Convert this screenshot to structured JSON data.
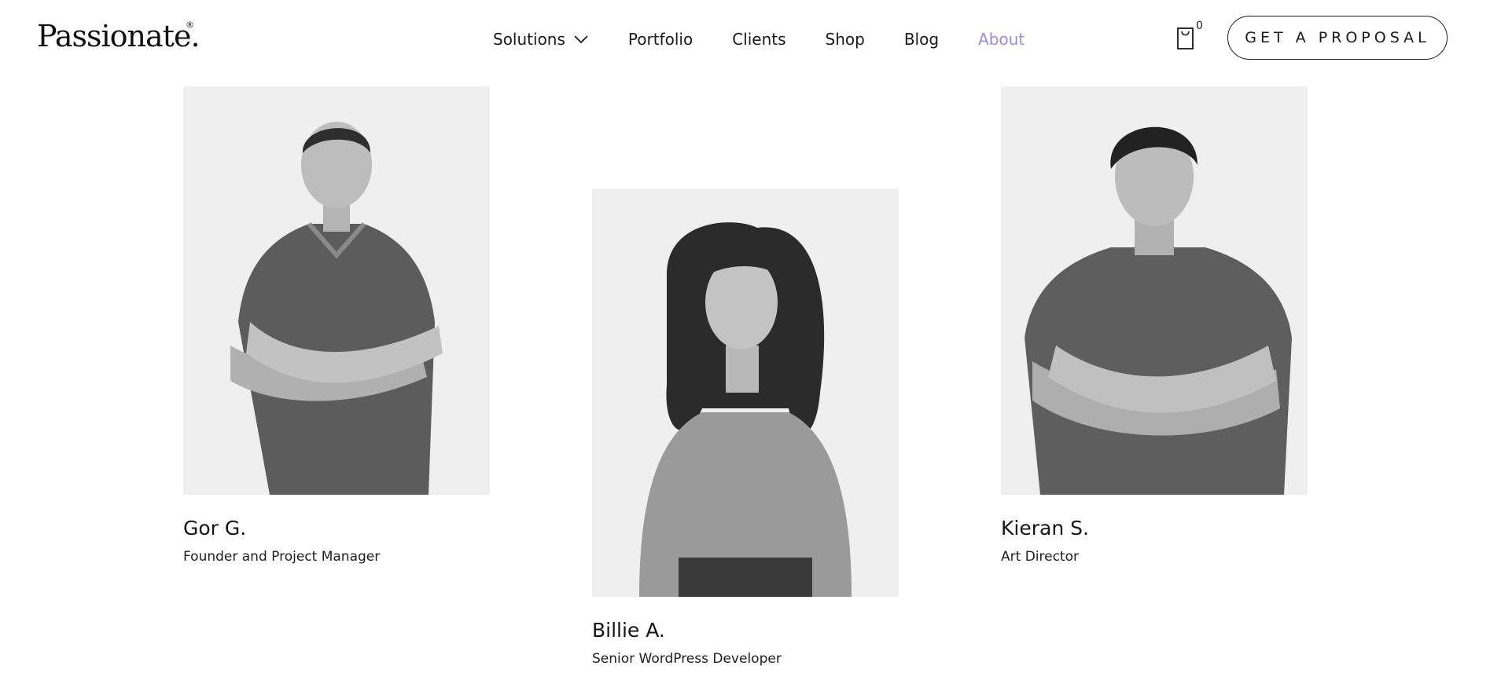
{
  "brand": {
    "logo_text": "Passionate.",
    "registered_mark": "®"
  },
  "nav": {
    "items": [
      {
        "label": "Solutions",
        "has_dropdown": true,
        "active": false
      },
      {
        "label": "Portfolio",
        "active": false
      },
      {
        "label": "Clients",
        "active": false
      },
      {
        "label": "Shop",
        "active": false
      },
      {
        "label": "Blog",
        "active": false
      },
      {
        "label": "About",
        "active": true
      }
    ],
    "dropdown_icon": "chevron-down-icon"
  },
  "cart": {
    "icon": "shopping-bag-icon",
    "count": "0"
  },
  "cta": {
    "label": "GET A PROPOSAL"
  },
  "team": [
    {
      "name": "Gor G.",
      "role": "Founder and Project Manager",
      "photo": "person-photo-icon"
    },
    {
      "name": "Billie A.",
      "role": "Senior WordPress Developer",
      "photo": "person-photo-icon"
    },
    {
      "name": "Kieran S.",
      "role": "Art Director",
      "photo": "person-photo-icon"
    }
  ],
  "colors": {
    "accent": "#9b8ae0",
    "text": "#141414",
    "photo_bg": "#efefef"
  }
}
